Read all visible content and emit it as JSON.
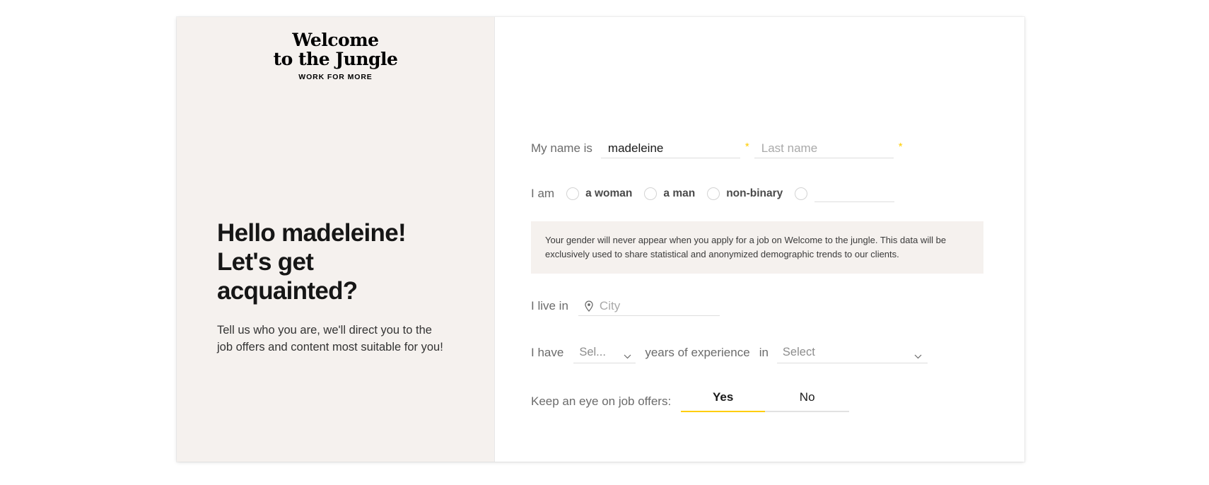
{
  "brand": {
    "logo_line_1": "Welcome",
    "logo_line_2": "to the Jungle",
    "tagline": "WORK FOR MORE",
    "accent_color": "#FFCD00",
    "panel_bg": "#F5F1EE"
  },
  "left": {
    "title": "Hello madeleine!\nLet's get\nacquainted?",
    "subtitle": "Tell us who you are, we'll direct you to the job offers and content most suitable for you!"
  },
  "form": {
    "name": {
      "label": "My name is",
      "first_value": "madeleine",
      "first_required_mark": "*",
      "last_placeholder": "Last name",
      "last_value": "",
      "last_required_mark": "*"
    },
    "gender": {
      "label": "I am",
      "options": [
        {
          "label": "a woman",
          "selected": false
        },
        {
          "label": "a man",
          "selected": false
        },
        {
          "label": "non-binary",
          "selected": false
        },
        {
          "label": "",
          "selected": false
        }
      ],
      "other_value": ""
    },
    "privacy_notice": "Your gender will never appear when you apply for a job on Welcome to the jungle. This data will be exclusively used to share statistical and anonymized demographic trends to our clients.",
    "city": {
      "label": "I live in",
      "placeholder": "City",
      "value": "",
      "icon": "location-pin-icon"
    },
    "experience": {
      "label": "I have",
      "years_selected": "Sel...",
      "mid_label": "years of experience",
      "in_label": "in",
      "field_selected": "Select",
      "chevron_icon": "chevron-down-icon"
    },
    "job_offers": {
      "label": "Keep an eye on job offers:",
      "options": [
        {
          "label": "Yes",
          "selected": true
        },
        {
          "label": "No",
          "selected": false
        }
      ]
    }
  }
}
